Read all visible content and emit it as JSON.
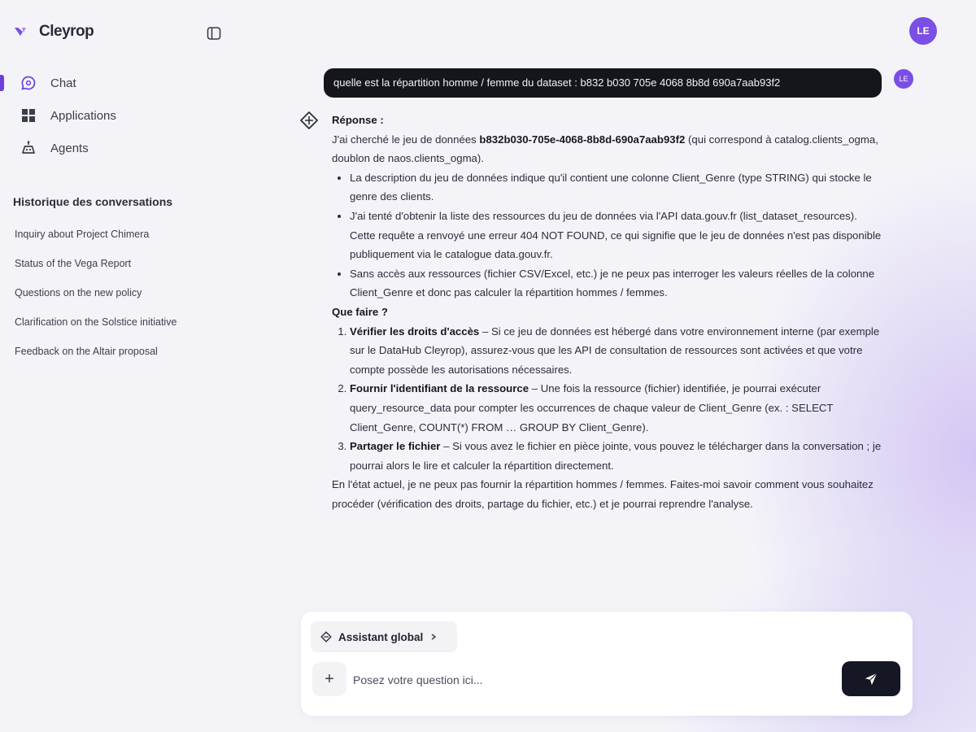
{
  "app": {
    "name": "Cleyrop"
  },
  "colors": {
    "accent": "#6d3fe0",
    "avatar": "#7b4ee6",
    "bubble": "#15161c",
    "send": "#151824"
  },
  "sidebar": {
    "collapse_icon": "sidebar-toggle-icon",
    "nav": [
      {
        "label": "Chat",
        "icon": "chat-icon",
        "active": true
      },
      {
        "label": "Applications",
        "icon": "grid-icon",
        "active": false
      },
      {
        "label": "Agents",
        "icon": "robot-icon",
        "active": false
      }
    ],
    "history_title": "Historique des conversations",
    "history": [
      "Inquiry about Project Chimera",
      "Status of the Vega Report",
      "Questions on the new policy",
      "Clarification on the Solstice initiative",
      "Feedback on the Altair proposal"
    ]
  },
  "user": {
    "initials": "LE",
    "initials_small": "LE"
  },
  "conversation": {
    "user_message": "quelle est la répartition homme / femme du dataset : b832 b030 705e 4068 8b8d 690a7aab93f2",
    "response": {
      "heading": "Réponse :",
      "intro_pre": "J'ai cherché le jeu de données ",
      "intro_id": "b832b030-705e-4068-8b8d-690a7aab93f2",
      "intro_post": " (qui correspond à catalog.clients_ogma, doublon de naos.clients_ogma).",
      "bullets": [
        "La description du jeu de données indique qu'il contient une colonne Client_Genre (type STRING) qui stocke le genre des clients.",
        "J'ai tenté d'obtenir la liste des ressources du jeu de données via l'API data.gouv.fr (list_dataset_resources). Cette requête a renvoyé une erreur 404 NOT FOUND, ce qui signifie que le jeu de données n'est pas disponible publiquement via le catalogue data.gouv.fr.",
        "Sans accès aux ressources (fichier CSV/Excel, etc.) je ne peux pas interroger les valeurs réelles de la colonne Client_Genre et donc pas calculer la répartition hommes / femmes."
      ],
      "what_to_do": "Que faire ?",
      "steps": [
        {
          "title": "Vérifier les droits d'accès",
          "text": " – Si ce jeu de données est hébergé dans votre environnement interne (par exemple sur le DataHub Cleyrop), assurez-vous que les API de consultation de ressources sont activées et que votre compte possède les autorisations nécessaires."
        },
        {
          "title": "Fournir l'identifiant de la ressource",
          "text": " – Une fois la ressource (fichier) identifiée, je pourrai exécuter query_resource_data pour compter les occurrences de chaque valeur de Client_Genre (ex. : SELECT Client_Genre, COUNT(*) FROM … GROUP BY Client_Genre)."
        },
        {
          "title": "Partager le fichier",
          "text": " – Si vous avez le fichier en pièce jointe, vous pouvez le télécharger dans la conversation ; je pourrai alors le lire et calculer la répartition directement."
        }
      ],
      "conclusion": "En l'état actuel, je ne peux pas fournir la répartition hommes / femmes. Faites-moi savoir comment vous souhaitez procéder (vérification des droits, partage du fichier, etc.) et je pourrai reprendre l'analyse."
    }
  },
  "composer": {
    "assistant_label": "Assistant global",
    "placeholder": "Posez votre question ici...",
    "plus_label": "+"
  }
}
